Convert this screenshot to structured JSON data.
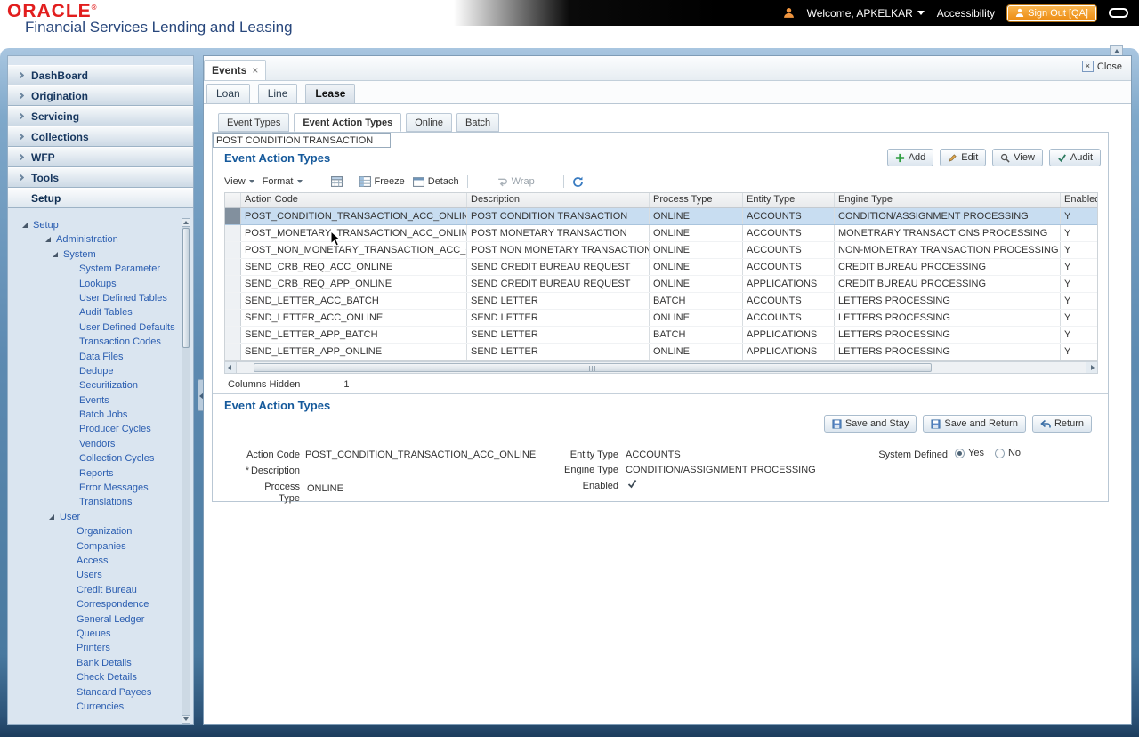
{
  "header": {
    "logo": "ORACLE",
    "logo_reg": "®",
    "product": "Financial Services Lending and Leasing",
    "welcome": "Welcome, APKELKAR",
    "accessibility": "Accessibility",
    "sign_out": "Sign Out [QA]"
  },
  "sidebar": {
    "menu": [
      {
        "label": "DashBoard",
        "chevron": true
      },
      {
        "label": "Origination",
        "chevron": true
      },
      {
        "label": "Servicing",
        "chevron": true
      },
      {
        "label": "Collections",
        "chevron": true
      },
      {
        "label": "WFP",
        "chevron": true
      },
      {
        "label": "Tools",
        "chevron": true
      },
      {
        "label": "Setup",
        "active": true
      }
    ],
    "tree": [
      {
        "label": "Setup",
        "indent": 16,
        "expander": true
      },
      {
        "label": "Administration",
        "indent": 42,
        "expander": true
      },
      {
        "label": "System",
        "indent": 50,
        "expander": true
      },
      {
        "label": "System Parameter",
        "indent": 80
      },
      {
        "label": "Lookups",
        "indent": 80
      },
      {
        "label": "User Defined Tables",
        "indent": 80
      },
      {
        "label": "Audit Tables",
        "indent": 80
      },
      {
        "label": "User Defined Defaults",
        "indent": 80
      },
      {
        "label": "Transaction Codes",
        "indent": 80
      },
      {
        "label": "Data Files",
        "indent": 80
      },
      {
        "label": "Dedupe",
        "indent": 80
      },
      {
        "label": "Securitization",
        "indent": 80
      },
      {
        "label": "Events",
        "indent": 80
      },
      {
        "label": "Batch Jobs",
        "indent": 80
      },
      {
        "label": "Producer Cycles",
        "indent": 80
      },
      {
        "label": "Vendors",
        "indent": 80
      },
      {
        "label": "Collection Cycles",
        "indent": 80
      },
      {
        "label": "Reports",
        "indent": 80
      },
      {
        "label": "Error Messages",
        "indent": 80
      },
      {
        "label": "Translations",
        "indent": 80
      },
      {
        "label": "User",
        "indent": 46,
        "expander": true
      },
      {
        "label": "Organization",
        "indent": 77
      },
      {
        "label": "Companies",
        "indent": 77
      },
      {
        "label": "Access",
        "indent": 77
      },
      {
        "label": "Users",
        "indent": 77
      },
      {
        "label": "Credit Bureau",
        "indent": 77
      },
      {
        "label": "Correspondence",
        "indent": 77
      },
      {
        "label": "General Ledger",
        "indent": 77
      },
      {
        "label": "Queues",
        "indent": 77
      },
      {
        "label": "Printers",
        "indent": 77
      },
      {
        "label": "Bank Details",
        "indent": 77
      },
      {
        "label": "Check Details",
        "indent": 77
      },
      {
        "label": "Standard Payees",
        "indent": 77
      },
      {
        "label": "Currencies",
        "indent": 77
      }
    ]
  },
  "workspace": {
    "tab": "Events",
    "close": "Close",
    "product_tabs": [
      {
        "label": "Loan"
      },
      {
        "label": "Line"
      },
      {
        "label": "Lease",
        "active": true
      }
    ],
    "sub_tabs": [
      {
        "label": "Event Types"
      },
      {
        "label": "Event Action Types",
        "active": true
      },
      {
        "label": "Online"
      },
      {
        "label": "Batch"
      }
    ]
  },
  "grid_section": {
    "title": "Event Action Types",
    "actions": [
      {
        "label": "Add"
      },
      {
        "label": "Edit"
      },
      {
        "label": "View"
      },
      {
        "label": "Audit"
      }
    ],
    "toolbar": {
      "view": "View",
      "format": "Format",
      "freeze": "Freeze",
      "detach": "Detach",
      "wrap": "Wrap"
    },
    "columns": [
      "Action Code",
      "Description",
      "Process Type",
      "Entity Type",
      "Engine Type",
      "Enabled"
    ],
    "rows": [
      {
        "selected": true,
        "cells": [
          "POST_CONDITION_TRANSACTION_ACC_ONLINE",
          "POST CONDITION TRANSACTION",
          "ONLINE",
          "ACCOUNTS",
          "CONDITION/ASSIGNMENT PROCESSING",
          "Y"
        ]
      },
      {
        "cells": [
          "POST_MONETARY_TRANSACTION_ACC_ONLINE",
          "POST MONETARY TRANSACTION",
          "ONLINE",
          "ACCOUNTS",
          "MONETRARY TRANSACTIONS PROCESSING",
          "Y"
        ]
      },
      {
        "cells": [
          "POST_NON_MONETARY_TRANSACTION_ACC_ON...",
          "POST NON MONETARY TRANSACTION",
          "ONLINE",
          "ACCOUNTS",
          "NON-MONETRAY TRANSACTION PROCESSING",
          "Y"
        ]
      },
      {
        "cells": [
          "SEND_CRB_REQ_ACC_ONLINE",
          "SEND CREDIT BUREAU REQUEST",
          "ONLINE",
          "ACCOUNTS",
          "CREDIT BUREAU PROCESSING",
          "Y"
        ]
      },
      {
        "cells": [
          "SEND_CRB_REQ_APP_ONLINE",
          "SEND CREDIT BUREAU REQUEST",
          "ONLINE",
          "APPLICATIONS",
          "CREDIT BUREAU PROCESSING",
          "Y"
        ]
      },
      {
        "cells": [
          "SEND_LETTER_ACC_BATCH",
          "SEND LETTER",
          "BATCH",
          "ACCOUNTS",
          "LETTERS PROCESSING",
          "Y"
        ]
      },
      {
        "cells": [
          "SEND_LETTER_ACC_ONLINE",
          "SEND LETTER",
          "ONLINE",
          "ACCOUNTS",
          "LETTERS PROCESSING",
          "Y"
        ]
      },
      {
        "cells": [
          "SEND_LETTER_APP_BATCH",
          "SEND LETTER",
          "BATCH",
          "APPLICATIONS",
          "LETTERS PROCESSING",
          "Y"
        ]
      },
      {
        "cells": [
          "SEND_LETTER_APP_ONLINE",
          "SEND LETTER",
          "ONLINE",
          "APPLICATIONS",
          "LETTERS PROCESSING",
          "Y"
        ]
      }
    ],
    "columns_hidden_label": "Columns Hidden",
    "columns_hidden_value": "1"
  },
  "form_section": {
    "title": "Event Action Types",
    "buttons": [
      {
        "label": "Save and Stay"
      },
      {
        "label": "Save and Return"
      },
      {
        "label": "Return"
      }
    ],
    "fields": {
      "action_code_label": "Action Code",
      "action_code": "POST_CONDITION_TRANSACTION_ACC_ONLINE",
      "description_required": "*",
      "description_label": "Description",
      "description": "POST CONDITION TRANSACTION",
      "process_type_label": "Process Type",
      "process_type": "ONLINE",
      "entity_type_label": "Entity Type",
      "entity_type": "ACCOUNTS",
      "engine_type_label": "Engine Type",
      "engine_type": "CONDITION/ASSIGNMENT PROCESSING",
      "enabled_label": "Enabled",
      "system_defined_label": "System Defined",
      "yes_label": "Yes",
      "no_label": "No"
    }
  }
}
